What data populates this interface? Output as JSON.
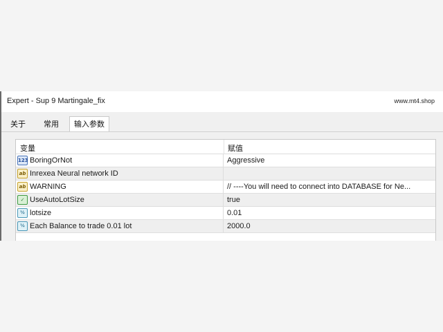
{
  "window": {
    "title": "Expert - Sup 9 Martingale_fix",
    "site": "www.mt4.shop"
  },
  "tabs": [
    {
      "label": "关于"
    },
    {
      "label": "常用"
    },
    {
      "label": "输入参数",
      "active": true
    }
  ],
  "table": {
    "headers": {
      "variable": "变量",
      "value": "赋值"
    },
    "rows": [
      {
        "icon": "integer-icon",
        "icon_text": "123",
        "name": "BoringOrNot",
        "value": "Aggressive"
      },
      {
        "icon": "string-icon",
        "icon_text": "ab",
        "name": "Inrexea Neural network ID",
        "value": ""
      },
      {
        "icon": "string-icon",
        "icon_text": "ab",
        "name": "WARNING",
        "value": "// ----You will need to connect into DATABASE for Ne..."
      },
      {
        "icon": "bool-icon",
        "icon_text": "✓",
        "name": "UseAutoLotSize",
        "value": "true"
      },
      {
        "icon": "double-icon",
        "icon_text": "½",
        "name": "lotsize",
        "value": "0.01"
      },
      {
        "icon": "double-icon",
        "icon_text": "½",
        "name": "Each Balance to trade 0.01 lot",
        "value": "2000.0"
      }
    ]
  }
}
